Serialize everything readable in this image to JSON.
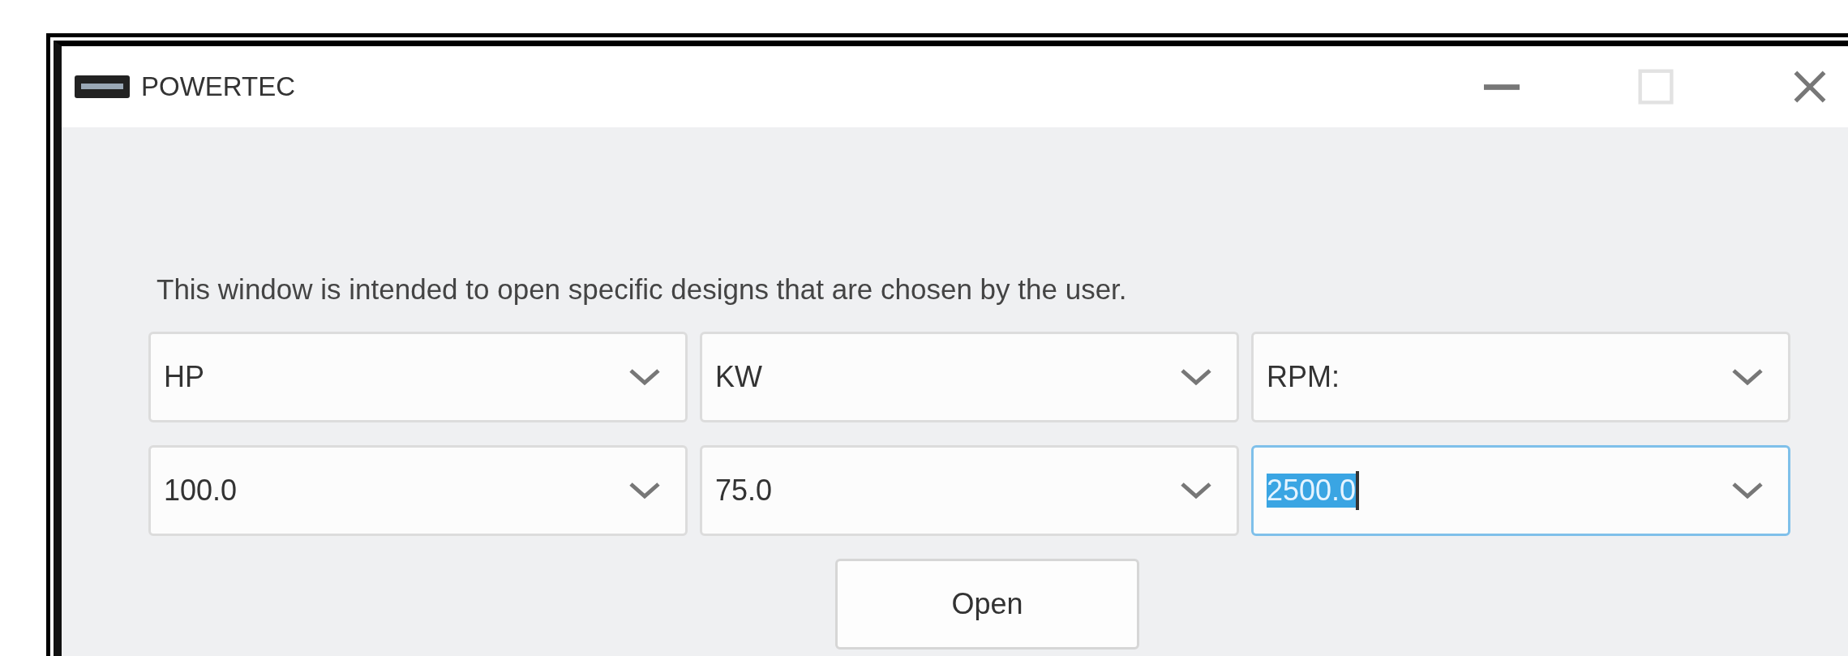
{
  "window": {
    "title": "POWERTEC"
  },
  "intro": "This window is intended to open specific designs that are chosen by the user.",
  "combo_rows": [
    {
      "combos": [
        {
          "value": "HP",
          "focused": false,
          "text_selected": false
        },
        {
          "value": "KW",
          "focused": false,
          "text_selected": false
        },
        {
          "value": "RPM:",
          "focused": false,
          "text_selected": false
        }
      ]
    },
    {
      "combos": [
        {
          "value": "100.0",
          "focused": false,
          "text_selected": false
        },
        {
          "value": "75.0",
          "focused": false,
          "text_selected": false
        },
        {
          "value": "2500.0",
          "focused": true,
          "text_selected": true
        }
      ]
    }
  ],
  "buttons": [
    {
      "label": "Open"
    }
  ]
}
